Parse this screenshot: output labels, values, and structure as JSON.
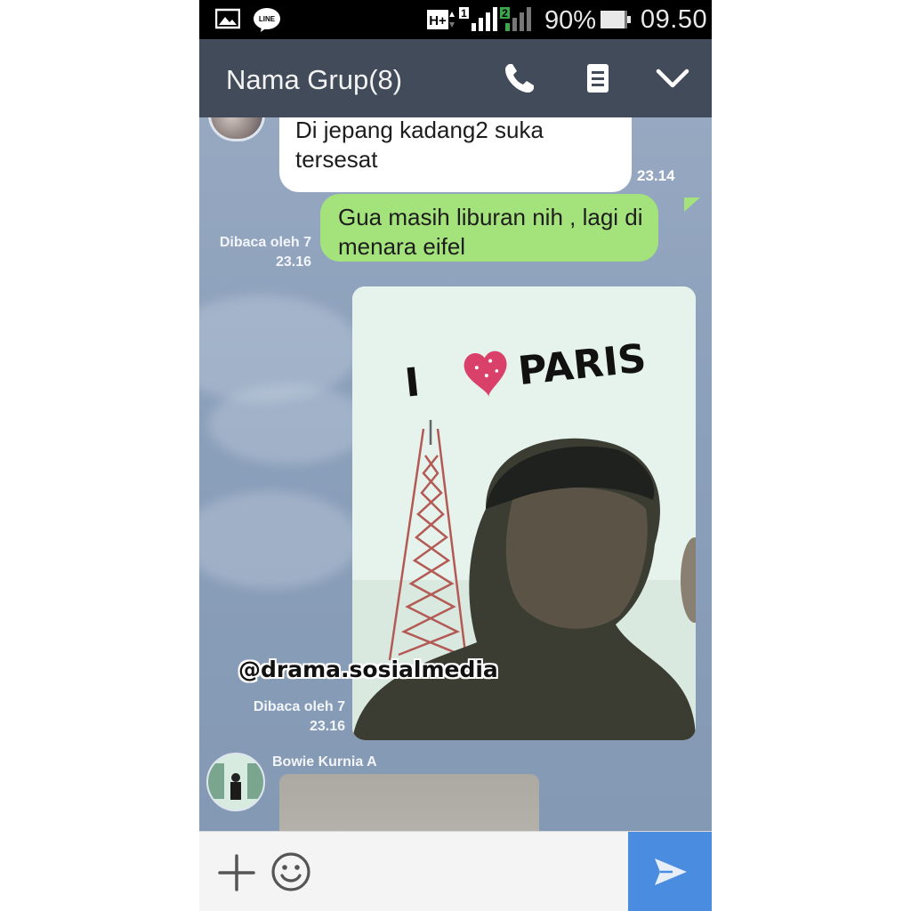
{
  "status_bar": {
    "network_label": "H+",
    "sim1_label": "1",
    "sim2_label": "2",
    "battery_pct": "90%",
    "battery_level": 0.9,
    "time": "09.50",
    "icons": [
      "gallery-icon",
      "line-icon",
      "hplus-network-icon",
      "signal-icon",
      "battery-icon"
    ],
    "line_badge": "LINE"
  },
  "header": {
    "title": "Nama Grup(8)",
    "icons": [
      "phone-icon",
      "note-icon",
      "chevron-down-icon"
    ]
  },
  "messages": [
    {
      "side": "left",
      "text_line1": "Di jepang kadang2 suka",
      "text_line2": "tersesat",
      "time": "23.14"
    },
    {
      "side": "right",
      "text_line1": "Gua masih liburan nih , lagi di",
      "text_line2": "menara eifel",
      "read": "Dibaca oleh 7",
      "time": "23.16"
    },
    {
      "side": "right",
      "type": "image",
      "caption": "I ♥ PARIS",
      "caption_I": "I",
      "caption_word": "PARIS",
      "read": "Dibaca oleh 7",
      "time": "23.16"
    },
    {
      "side": "left",
      "sender": "Bowie Kurnia A",
      "type": "image"
    }
  ],
  "watermark": "@drama.sosialmedia",
  "input_bar": {
    "icons": [
      "plus-icon",
      "emoji-icon",
      "send-icon"
    ]
  },
  "colors": {
    "header_bg": "#424b59",
    "chat_bg": "#8ea3bd",
    "sent_bubble": "#a4e37c",
    "received_bubble": "#ffffff",
    "send_button": "#4a8ce0",
    "heart": "#d9416a"
  }
}
